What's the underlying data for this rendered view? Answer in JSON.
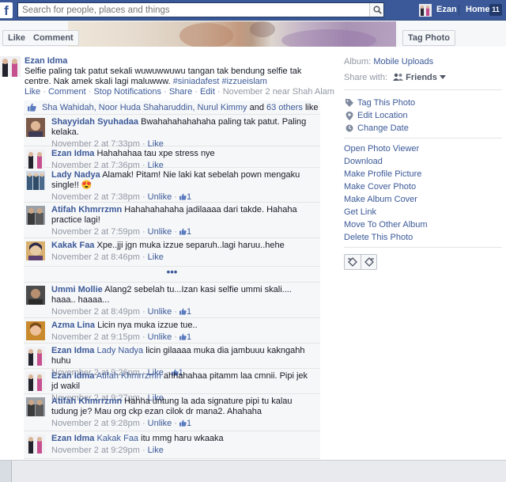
{
  "topbar": {
    "logo": "f",
    "search_placeholder": "Search for people, places and things",
    "user_name": "Ezan",
    "home_label": "Home",
    "home_count": "11",
    "brand_color": "#3b5998"
  },
  "photo": {
    "like_label": "Like",
    "comment_label": "Comment",
    "tag_photo_label": "Tag Photo"
  },
  "post": {
    "author": "Ezan Idma",
    "caption_text": "Selfie paling tak patut sekali wuwuwwuwu tangan tak bendung selfie tak centre. Nak amek skali lagi maluwww.",
    "hashtags": "#siniadafest #izzueislam",
    "actions": {
      "like": "Like",
      "comment": "Comment",
      "stop": "Stop Notifications",
      "share": "Share",
      "edit": "Edit",
      "meta": "November 2 near Shah Alam"
    },
    "likes": {
      "names": "Sha Wahidah, Noor Huda Shaharuddin, Nurul Kimmy",
      "and": "and",
      "others": "63 others",
      "suffix": "like this."
    }
  },
  "comments": [
    {
      "name": "Shayyidah Syuhadaa",
      "tag": "",
      "text": "Bwahahahahahaha paling tak patut. Paling kelaka.",
      "time": "November 2 at 7:33pm",
      "action": "Like",
      "likes": ""
    },
    {
      "name": "Ezan Idma",
      "tag": "",
      "text": "Hahahahaa tau xpe stress nye",
      "time": "November 2 at 7:36pm",
      "action": "Like",
      "likes": ""
    },
    {
      "name": "Lady Nadya",
      "tag": "",
      "text": "Alamak! Pitam! Nie laki kat sebelah pown mengaku single!! 😍",
      "time": "November 2 at 7:38pm",
      "action": "Unlike",
      "likes": "1"
    },
    {
      "name": "Atifah Khmrrzmn",
      "tag": "",
      "text": "Hahahahahaha jadilaaaa dari takde. Hahaha practice lagi!",
      "time": "November 2 at 7:59pm",
      "action": "Unlike",
      "likes": "1"
    },
    {
      "name": "Kakak Faa",
      "tag": "",
      "text": "Xpe..jji jgn muka izzue separuh..lagi haruu..hehe",
      "time": "November 2 at 8:46pm",
      "action": "Like",
      "likes": ""
    },
    {
      "name": "Ummi Mollie",
      "tag": "",
      "text": "Alang2 sebelah tu...Izan kasi selfie ummi skali.... haaa.. haaaa...",
      "time": "November 2 at 8:49pm",
      "action": "Unlike",
      "likes": "1"
    },
    {
      "name": "Azma Lina",
      "tag": "",
      "text": "Licin nya muka izzue tue..",
      "time": "November 2 at 9:15pm",
      "action": "Unlike",
      "likes": "1"
    },
    {
      "name": "Ezan Idma",
      "tag": "Lady Nadya",
      "text": "licin gilaaaa muka dia jambuuu kakngahh huhu",
      "time": "November 2 at 9:26pm",
      "action": "Like",
      "likes": "1"
    },
    {
      "name": "Ezan Idma",
      "tag": "Atifah Khmrrzmn",
      "text": "ahhahahaa pitamm laa cmnii. Pipi jek jd wakil",
      "time": "November 2 at 9:27pm",
      "action": "Like",
      "likes": ""
    },
    {
      "name": "Atifah Khmrrzmn",
      "tag": "",
      "text": "Hahha untung la ada signature pipi tu kalau tudung je? Mau org ckp ezan cilok dr mana2. Ahahaha",
      "time": "November 2 at 9:28pm",
      "action": "Unlike",
      "likes": "1"
    },
    {
      "name": "Ezan Idma",
      "tag": "Kakak Faa",
      "text": "itu mmg haru wkaaka",
      "time": "November 2 at 9:29pm",
      "action": "Like",
      "likes": ""
    }
  ],
  "more_comments": "•••",
  "sidebar": {
    "album_label": "Album:",
    "album_name": "Mobile Uploads",
    "share_label": "Share with:",
    "share_value": "Friends",
    "icon_links": [
      "Tag This Photo",
      "Edit Location",
      "Change Date"
    ],
    "links": [
      "Open Photo Viewer",
      "Download",
      "Make Profile Picture",
      "Make Cover Photo",
      "Make Album Cover",
      "Get Link",
      "Move To Other Album",
      "Delete This Photo"
    ]
  },
  "icons": {
    "search": "search-icon",
    "thumb": "thumbs-up-icon",
    "friends": "friends-icon",
    "tag": "tag-icon",
    "location": "location-pin-icon",
    "clock": "clock-icon",
    "rotate_left": "rotate-left-icon",
    "rotate_right": "rotate-right-icon"
  }
}
